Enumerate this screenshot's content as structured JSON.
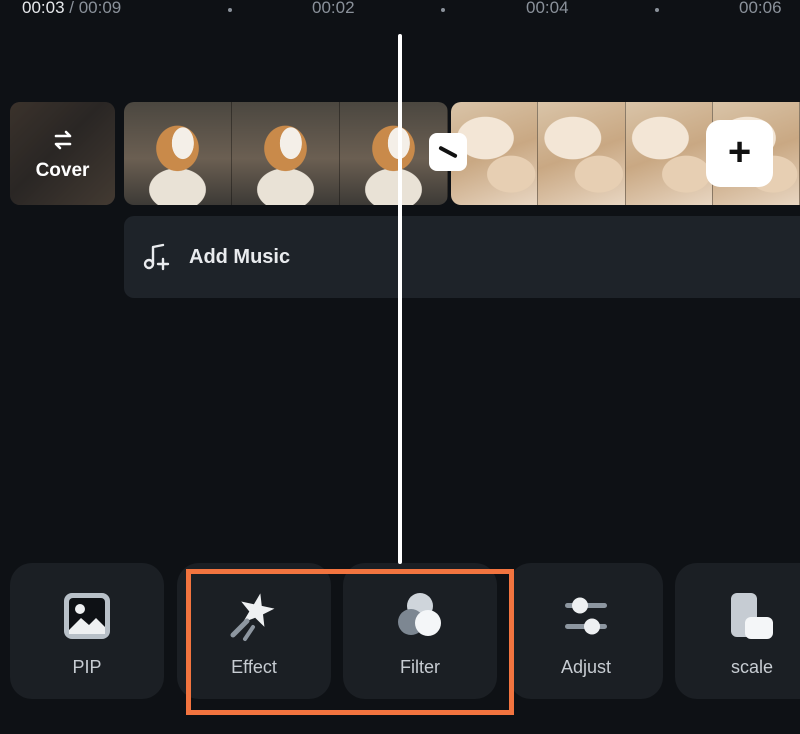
{
  "timeline": {
    "current_time": "00:03",
    "separator": " / ",
    "total_time": "00:09",
    "ruler": [
      "00:02",
      "00:04",
      "00:06"
    ]
  },
  "cover": {
    "label": "Cover",
    "icon": "swap-arrows-icon"
  },
  "clips": [
    {
      "name": "dog-video-clip",
      "frames": 3
    },
    {
      "name": "cat-video-clip",
      "frames": 4
    }
  ],
  "add_music": {
    "label": "Add Music",
    "icon": "music-plus-icon"
  },
  "tools": [
    {
      "label": "PIP",
      "icon": "image-icon"
    },
    {
      "label": "Effect",
      "icon": "sparkle-star-icon"
    },
    {
      "label": "Filter",
      "icon": "filter-circles-icon"
    },
    {
      "label": "Adjust",
      "icon": "sliders-icon"
    },
    {
      "label": "scale",
      "icon": "scale-icon"
    }
  ],
  "colors": {
    "background": "#0e1115",
    "panel": "#1b1f24",
    "highlight": "#f2743f",
    "text_muted": "#8a919a"
  }
}
